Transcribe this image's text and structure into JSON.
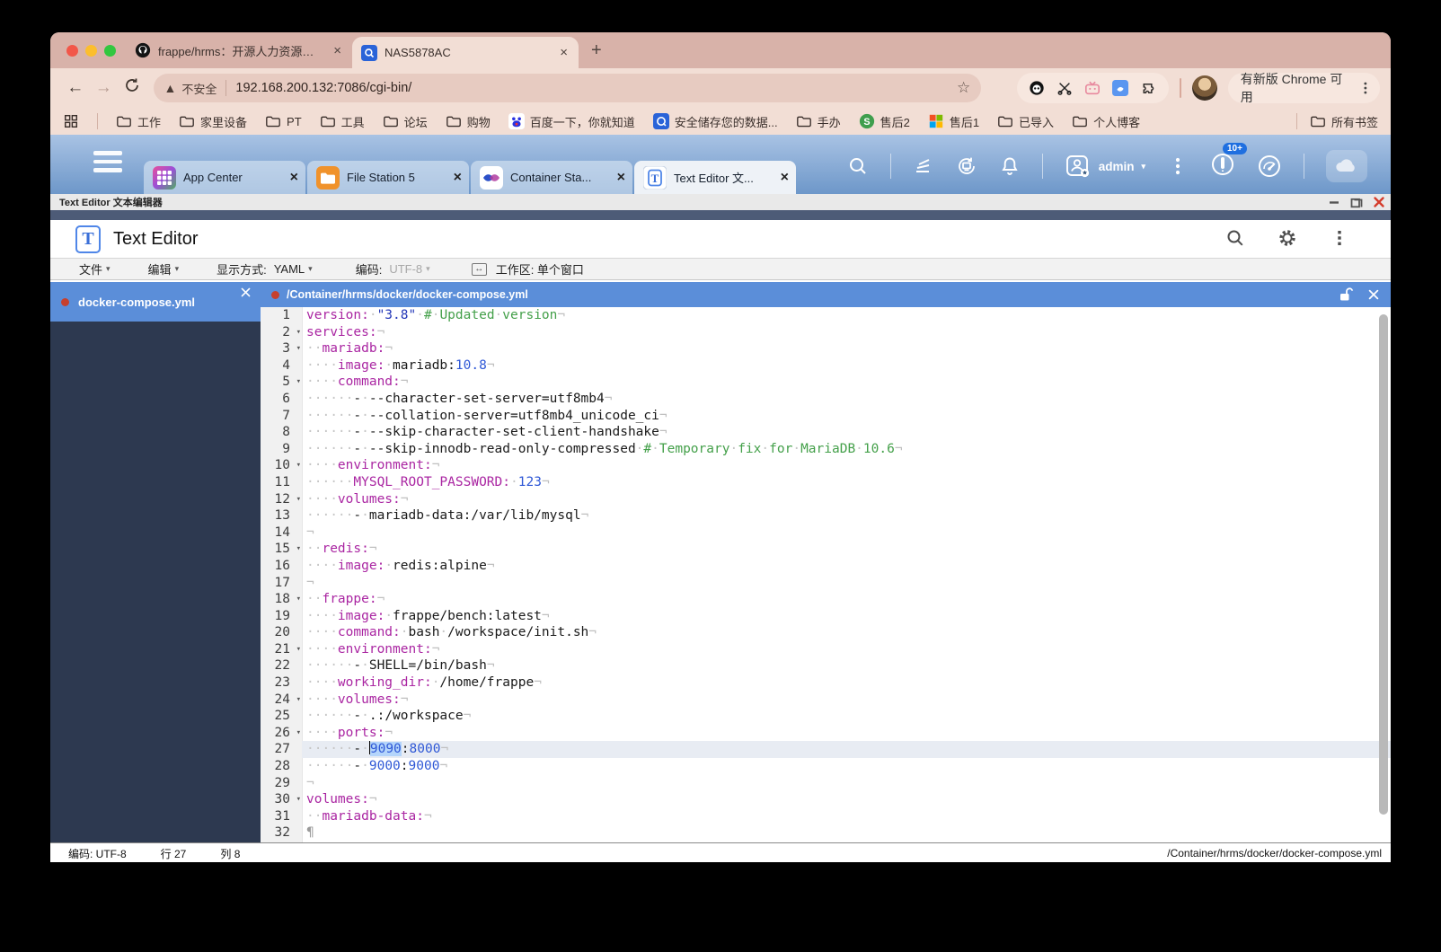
{
  "browser": {
    "tabs": [
      {
        "title": "frappe/hrms：开源人力资源和…",
        "icon": "github-icon",
        "active": false
      },
      {
        "title": "NAS5878AC",
        "icon": "nas-favicon",
        "active": true
      }
    ],
    "new_tab": "+",
    "nav": {
      "back": "←",
      "forward": "→"
    },
    "omnibox": {
      "security": "不安全",
      "url": "192.168.200.132:7086/cgi-bin/"
    },
    "update_chip": "有新版 Chrome 可用",
    "bookmarks": [
      {
        "label": "工作",
        "icon": "folder"
      },
      {
        "label": "家里设备",
        "icon": "folder"
      },
      {
        "label": "PT",
        "icon": "folder"
      },
      {
        "label": "工具",
        "icon": "folder"
      },
      {
        "label": "论坛",
        "icon": "folder"
      },
      {
        "label": "购物",
        "icon": "folder"
      },
      {
        "label": "百度一下，你就知道",
        "icon": "baidu"
      },
      {
        "label": "安全储存您的数据...",
        "icon": "qsync"
      },
      {
        "label": "手办",
        "icon": "folder"
      },
      {
        "label": "售后2",
        "icon": "shop"
      },
      {
        "label": "售后1",
        "icon": "ms"
      },
      {
        "label": "已导入",
        "icon": "folder"
      },
      {
        "label": "个人博客",
        "icon": "folder"
      }
    ],
    "all_bookmarks": "所有书签"
  },
  "taskbar": {
    "apps": [
      {
        "label": "App Center",
        "icon": "appcenter",
        "active": false
      },
      {
        "label": "File Station 5",
        "icon": "filestation",
        "active": false
      },
      {
        "label": "Container Sta...",
        "icon": "container",
        "active": false
      },
      {
        "label": "Text Editor 文...",
        "icon": "texteditor",
        "active": true
      }
    ],
    "user": "admin",
    "notification_badge": "10+"
  },
  "window": {
    "titlebar": "Text Editor 文本编辑器",
    "app_title": "Text Editor",
    "menu": {
      "file": "文件",
      "edit": "编辑",
      "view_label": "显示方式:",
      "view_value": "YAML",
      "encoding_label": "编码:",
      "encoding_value": "UTF-8",
      "workspace": "工作区: 单个窗口"
    },
    "sidebar_file": "docker-compose.yml",
    "doc_path": "/Container/hrms/docker/docker-compose.yml",
    "statusbar": {
      "encoding": "编码: UTF-8",
      "line": "行 27",
      "col": "列 8",
      "path": "/Container/hrms/docker/docker-compose.yml"
    }
  },
  "colors": {
    "accent_blue": "#5b8ed9",
    "key": "#aa26a2",
    "number": "#2f58d6",
    "string": "#2438b8",
    "comment": "#44a04a",
    "selection": "#b4d5fb"
  },
  "code": {
    "lines": [
      {
        "n": 1,
        "tokens": [
          [
            "k",
            "version:"
          ],
          [
            "w",
            "·"
          ],
          [
            "s",
            "\"3.8\""
          ],
          [
            "w",
            "·"
          ],
          [
            "c",
            "#"
          ],
          [
            "w",
            "·"
          ],
          [
            "c",
            "Updated"
          ],
          [
            "w",
            "·"
          ],
          [
            "c",
            "version"
          ],
          [
            "e",
            "¬"
          ]
        ]
      },
      {
        "n": 2,
        "fold": true,
        "tokens": [
          [
            "k",
            "services:"
          ],
          [
            "e",
            "¬"
          ]
        ]
      },
      {
        "n": 3,
        "fold": true,
        "tokens": [
          [
            "w",
            "··"
          ],
          [
            "k",
            "mariadb:"
          ],
          [
            "e",
            "¬"
          ]
        ]
      },
      {
        "n": 4,
        "tokens": [
          [
            "w",
            "····"
          ],
          [
            "k",
            "image:"
          ],
          [
            "w",
            "·"
          ],
          [
            "t",
            "mariadb:"
          ],
          [
            "n",
            "10.8"
          ],
          [
            "e",
            "¬"
          ]
        ]
      },
      {
        "n": 5,
        "fold": true,
        "tokens": [
          [
            "w",
            "····"
          ],
          [
            "k",
            "command:"
          ],
          [
            "e",
            "¬"
          ]
        ]
      },
      {
        "n": 6,
        "tokens": [
          [
            "w",
            "······"
          ],
          [
            "t",
            "-"
          ],
          [
            "w",
            "·"
          ],
          [
            "t",
            "--character-set-server=utf8mb4"
          ],
          [
            "e",
            "¬"
          ]
        ]
      },
      {
        "n": 7,
        "tokens": [
          [
            "w",
            "······"
          ],
          [
            "t",
            "-"
          ],
          [
            "w",
            "·"
          ],
          [
            "t",
            "--collation-server=utf8mb4_unicode_ci"
          ],
          [
            "e",
            "¬"
          ]
        ]
      },
      {
        "n": 8,
        "tokens": [
          [
            "w",
            "······"
          ],
          [
            "t",
            "-"
          ],
          [
            "w",
            "·"
          ],
          [
            "t",
            "--skip-character-set-client-handshake"
          ],
          [
            "e",
            "¬"
          ]
        ]
      },
      {
        "n": 9,
        "tokens": [
          [
            "w",
            "······"
          ],
          [
            "t",
            "-"
          ],
          [
            "w",
            "·"
          ],
          [
            "t",
            "--skip-innodb-read-only-compressed"
          ],
          [
            "w",
            "·"
          ],
          [
            "c",
            "#"
          ],
          [
            "w",
            "·"
          ],
          [
            "c",
            "Temporary"
          ],
          [
            "w",
            "·"
          ],
          [
            "c",
            "fix"
          ],
          [
            "w",
            "·"
          ],
          [
            "c",
            "for"
          ],
          [
            "w",
            "·"
          ],
          [
            "c",
            "MariaDB"
          ],
          [
            "w",
            "·"
          ],
          [
            "c",
            "10.6"
          ],
          [
            "e",
            "¬"
          ]
        ]
      },
      {
        "n": 10,
        "fold": true,
        "tokens": [
          [
            "w",
            "····"
          ],
          [
            "k",
            "environment:"
          ],
          [
            "e",
            "¬"
          ]
        ]
      },
      {
        "n": 11,
        "tokens": [
          [
            "w",
            "······"
          ],
          [
            "k",
            "MYSQL_ROOT_PASSWORD:"
          ],
          [
            "w",
            "·"
          ],
          [
            "n",
            "123"
          ],
          [
            "e",
            "¬"
          ]
        ]
      },
      {
        "n": 12,
        "fold": true,
        "tokens": [
          [
            "w",
            "····"
          ],
          [
            "k",
            "volumes:"
          ],
          [
            "e",
            "¬"
          ]
        ]
      },
      {
        "n": 13,
        "tokens": [
          [
            "w",
            "······"
          ],
          [
            "t",
            "-"
          ],
          [
            "w",
            "·"
          ],
          [
            "t",
            "mariadb-data:/var/lib/mysql"
          ],
          [
            "e",
            "¬"
          ]
        ]
      },
      {
        "n": 14,
        "tokens": [
          [
            "e",
            "¬"
          ]
        ]
      },
      {
        "n": 15,
        "fold": true,
        "tokens": [
          [
            "w",
            "··"
          ],
          [
            "k",
            "redis:"
          ],
          [
            "e",
            "¬"
          ]
        ]
      },
      {
        "n": 16,
        "tokens": [
          [
            "w",
            "····"
          ],
          [
            "k",
            "image:"
          ],
          [
            "w",
            "·"
          ],
          [
            "t",
            "redis:alpine"
          ],
          [
            "e",
            "¬"
          ]
        ]
      },
      {
        "n": 17,
        "tokens": [
          [
            "e",
            "¬"
          ]
        ]
      },
      {
        "n": 18,
        "fold": true,
        "tokens": [
          [
            "w",
            "··"
          ],
          [
            "k",
            "frappe:"
          ],
          [
            "e",
            "¬"
          ]
        ]
      },
      {
        "n": 19,
        "tokens": [
          [
            "w",
            "····"
          ],
          [
            "k",
            "image:"
          ],
          [
            "w",
            "·"
          ],
          [
            "t",
            "frappe/bench:latest"
          ],
          [
            "e",
            "¬"
          ]
        ]
      },
      {
        "n": 20,
        "tokens": [
          [
            "w",
            "····"
          ],
          [
            "k",
            "command:"
          ],
          [
            "w",
            "·"
          ],
          [
            "t",
            "bash"
          ],
          [
            "w",
            "·"
          ],
          [
            "t",
            "/workspace/init.sh"
          ],
          [
            "e",
            "¬"
          ]
        ]
      },
      {
        "n": 21,
        "fold": true,
        "tokens": [
          [
            "w",
            "····"
          ],
          [
            "k",
            "environment:"
          ],
          [
            "e",
            "¬"
          ]
        ]
      },
      {
        "n": 22,
        "tokens": [
          [
            "w",
            "······"
          ],
          [
            "t",
            "-"
          ],
          [
            "w",
            "·"
          ],
          [
            "t",
            "SHELL=/bin/bash"
          ],
          [
            "e",
            "¬"
          ]
        ]
      },
      {
        "n": 23,
        "tokens": [
          [
            "w",
            "····"
          ],
          [
            "k",
            "working_dir:"
          ],
          [
            "w",
            "·"
          ],
          [
            "t",
            "/home/frappe"
          ],
          [
            "e",
            "¬"
          ]
        ]
      },
      {
        "n": 24,
        "fold": true,
        "tokens": [
          [
            "w",
            "····"
          ],
          [
            "k",
            "volumes:"
          ],
          [
            "e",
            "¬"
          ]
        ]
      },
      {
        "n": 25,
        "tokens": [
          [
            "w",
            "······"
          ],
          [
            "t",
            "-"
          ],
          [
            "w",
            "·"
          ],
          [
            "t",
            ".:/workspace"
          ],
          [
            "e",
            "¬"
          ]
        ]
      },
      {
        "n": 26,
        "fold": true,
        "tokens": [
          [
            "w",
            "····"
          ],
          [
            "k",
            "ports:"
          ],
          [
            "e",
            "¬"
          ]
        ]
      },
      {
        "n": 27,
        "cur": true,
        "tokens": [
          [
            "w",
            "······"
          ],
          [
            "t",
            "-"
          ],
          [
            "w",
            "·"
          ],
          [
            "cursor",
            ""
          ],
          [
            "nsel",
            "9090"
          ],
          [
            "t",
            ":"
          ],
          [
            "n",
            "8000"
          ],
          [
            "e",
            "¬"
          ]
        ]
      },
      {
        "n": 28,
        "tokens": [
          [
            "w",
            "······"
          ],
          [
            "t",
            "-"
          ],
          [
            "w",
            "·"
          ],
          [
            "n",
            "9000"
          ],
          [
            "t",
            ":"
          ],
          [
            "n",
            "9000"
          ],
          [
            "e",
            "¬"
          ]
        ]
      },
      {
        "n": 29,
        "tokens": [
          [
            "e",
            "¬"
          ]
        ]
      },
      {
        "n": 30,
        "fold": true,
        "tokens": [
          [
            "k",
            "volumes:"
          ],
          [
            "e",
            "¬"
          ]
        ]
      },
      {
        "n": 31,
        "tokens": [
          [
            "w",
            "··"
          ],
          [
            "k",
            "mariadb-data:"
          ],
          [
            "e",
            "¬"
          ]
        ]
      },
      {
        "n": 32,
        "tokens": [
          [
            "p",
            "¶"
          ]
        ]
      }
    ]
  }
}
